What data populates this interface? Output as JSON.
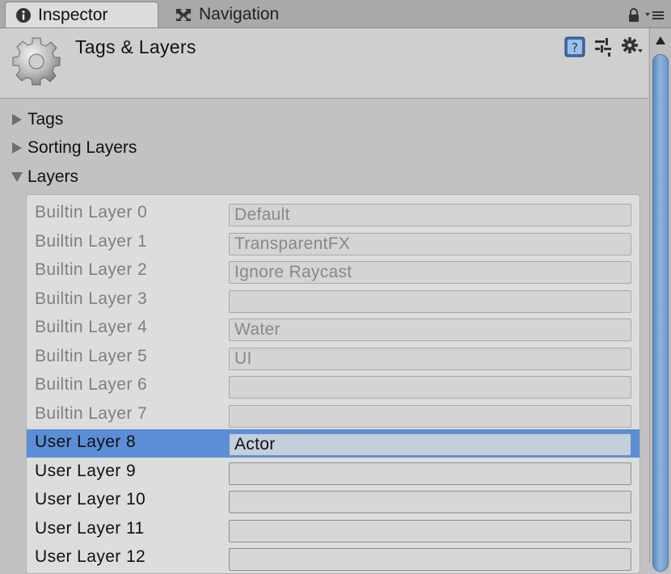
{
  "tabs": [
    {
      "label": "Inspector",
      "icon": "info-icon",
      "active": true
    },
    {
      "label": "Navigation",
      "icon": "navigation-icon",
      "active": false
    }
  ],
  "header": {
    "title": "Tags & Layers",
    "icon": "gear-icon"
  },
  "foldouts": {
    "tags": {
      "label": "Tags",
      "expanded": false
    },
    "sorting_layers": {
      "label": "Sorting Layers",
      "expanded": false
    },
    "layers": {
      "label": "Layers",
      "expanded": true
    }
  },
  "layers": [
    {
      "label": "Builtin Layer 0",
      "value": "Default",
      "kind": "builtin"
    },
    {
      "label": "Builtin Layer 1",
      "value": "TransparentFX",
      "kind": "builtin"
    },
    {
      "label": "Builtin Layer 2",
      "value": "Ignore Raycast",
      "kind": "builtin"
    },
    {
      "label": "Builtin Layer 3",
      "value": "",
      "kind": "builtin"
    },
    {
      "label": "Builtin Layer 4",
      "value": "Water",
      "kind": "builtin"
    },
    {
      "label": "Builtin Layer 5",
      "value": "UI",
      "kind": "builtin"
    },
    {
      "label": "Builtin Layer 6",
      "value": "",
      "kind": "builtin"
    },
    {
      "label": "Builtin Layer 7",
      "value": "",
      "kind": "builtin"
    },
    {
      "label": "User Layer 8",
      "value": "Actor",
      "kind": "user",
      "selected": true
    },
    {
      "label": "User Layer 9",
      "value": "",
      "kind": "user"
    },
    {
      "label": "User Layer 10",
      "value": "",
      "kind": "user"
    },
    {
      "label": "User Layer 11",
      "value": "",
      "kind": "user"
    },
    {
      "label": "User Layer 12",
      "value": "",
      "kind": "user"
    }
  ],
  "colors": {
    "selection": "#5b8ed6",
    "scroll_thumb": "#7aa3d3"
  }
}
